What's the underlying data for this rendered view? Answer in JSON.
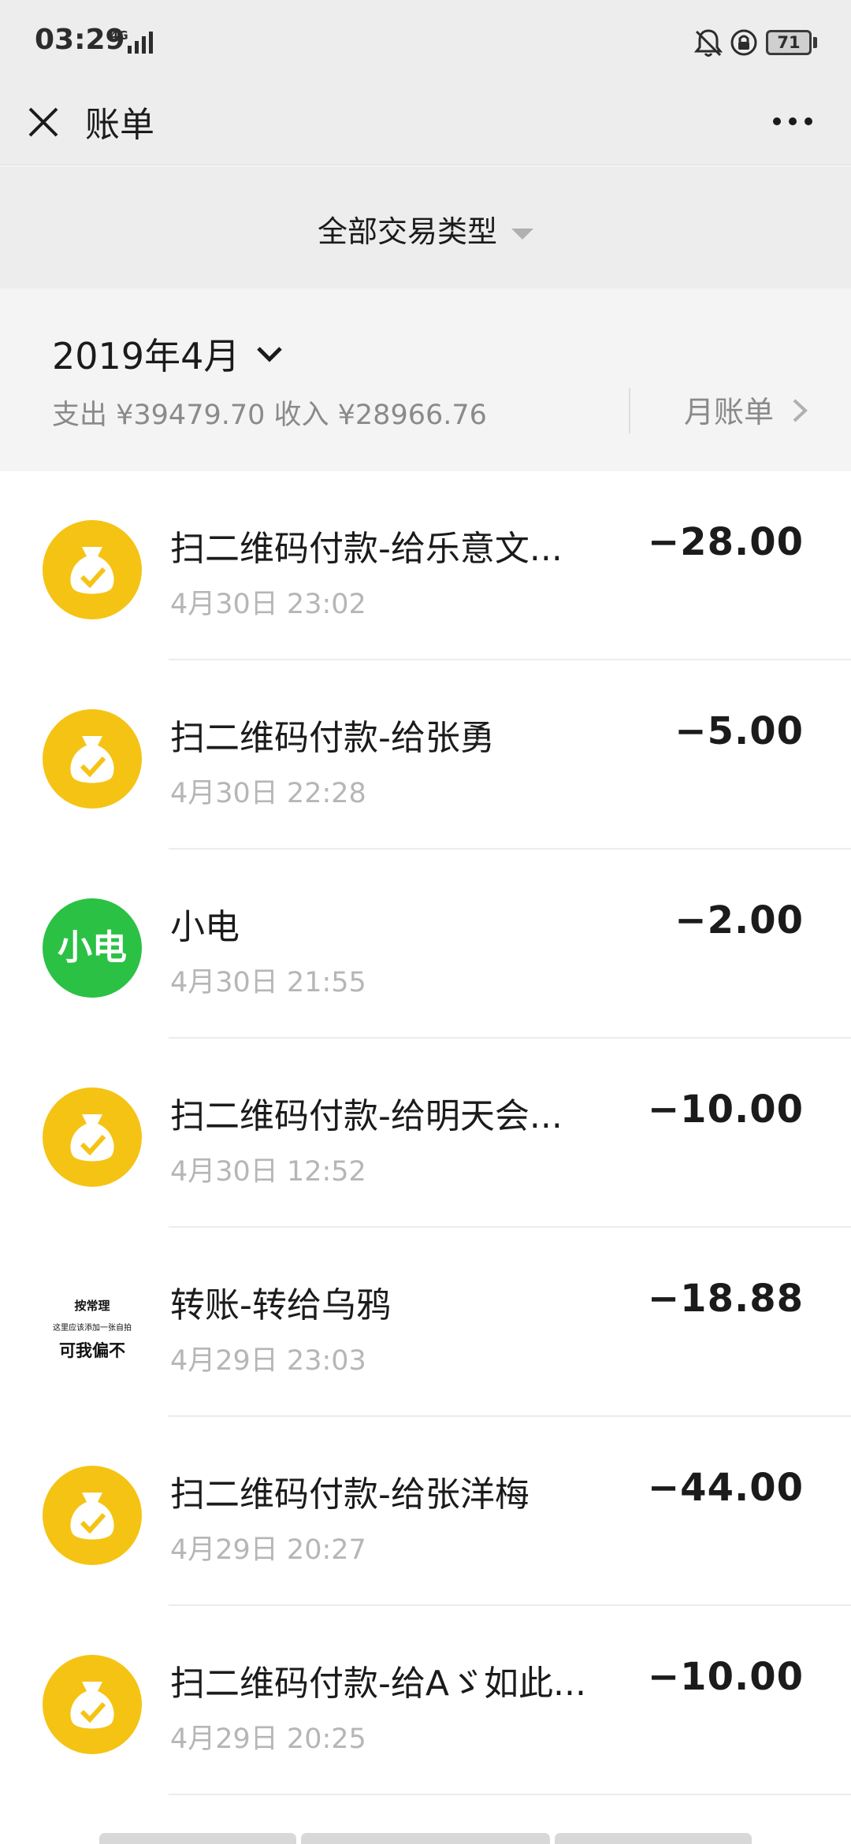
{
  "status_bar": {
    "time": "03:29",
    "network": "4G",
    "battery": "71"
  },
  "nav": {
    "title": "账单"
  },
  "filter": {
    "label": "全部交易类型"
  },
  "month": {
    "title": "2019年4月",
    "summary": "支出 ¥39479.70 收入 ¥28966.76",
    "monthly_bill_label": "月账单"
  },
  "transactions": [
    {
      "title": "扫二维码付款-给乐意文...",
      "time": "4月30日 23:02",
      "amount": "−28.00",
      "avatar": "money-bag-icon"
    },
    {
      "title": "扫二维码付款-给张勇",
      "time": "4月30日 22:28",
      "amount": "−5.00",
      "avatar": "money-bag-icon"
    },
    {
      "title": "小电",
      "time": "4月30日 21:55",
      "amount": "−2.00",
      "avatar": "小电"
    },
    {
      "title": "扫二维码付款-给明天会...",
      "time": "4月30日 12:52",
      "amount": "−10.00",
      "avatar": "money-bag-icon"
    },
    {
      "title": "转账-转给乌鸦",
      "time": "4月29日 23:03",
      "amount": "−18.88",
      "avatar": {
        "line1": "按常理",
        "line2": "这里应该添加一张自拍",
        "line3": "可我偏不"
      }
    },
    {
      "title": "扫二维码付款-给张洋梅",
      "time": "4月29日 20:27",
      "amount": "−44.00",
      "avatar": "money-bag-icon"
    },
    {
      "title": "扫二维码付款-给Aゞ如此...",
      "time": "4月29日 20:25",
      "amount": "−10.00",
      "avatar": "money-bag-icon"
    }
  ],
  "colors": {
    "header_bg": "#ededed",
    "summary_bg": "#f4f4f4",
    "avatar_yellow": "#f5c313",
    "avatar_green": "#2bc144",
    "secondary_text": "#b6b6b6"
  }
}
